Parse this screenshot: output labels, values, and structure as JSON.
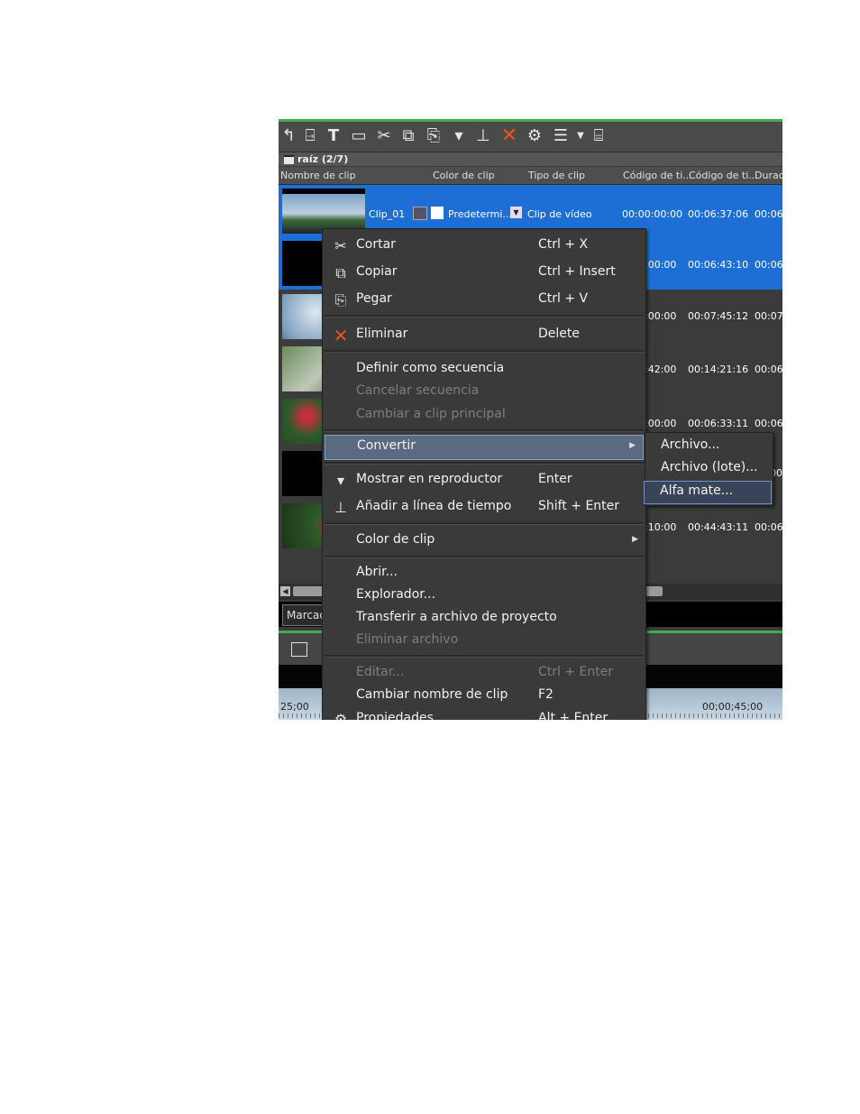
{
  "bin": {
    "label": "raíz (2/7)"
  },
  "columns": [
    "Nombre de clip",
    "Color de clip",
    "Tipo de clip",
    "Código de ti...",
    "Código de ti...",
    "Durac"
  ],
  "rows": [
    {
      "name": "Clip_01",
      "color_label": "Predetermi...",
      "type": "Clip de vídeo",
      "tc_in": "00:00:00:00",
      "tc_out": "00:06:37:06",
      "dur": "00:06:",
      "selected": true
    },
    {
      "tc_in": ":00:00",
      "tc_out": "00:06:43:10",
      "dur": "00:06:",
      "selected": true
    },
    {
      "tc_in": ":00:00",
      "tc_out": "00:07:45:12",
      "dur": "00:07:"
    },
    {
      "tc_in": ":42:00",
      "tc_out": "00:14:21:16",
      "dur": "00:06:"
    },
    {
      "tc_in": ":00:00",
      "tc_out": "00:06:33:11",
      "dur": "00:06:"
    },
    {
      "tc_in": "",
      "tc_out": "",
      "dur": "00:"
    },
    {
      "tc_in": ":10:00",
      "tc_out": "00:44:43:11",
      "dur": "00:06:"
    }
  ],
  "marcas_tab": "Marcad",
  "ruler": {
    "left_tc": "25;00",
    "right_tc": "00;00;45;00"
  },
  "context_menu": {
    "cut": {
      "label": "Cortar",
      "shortcut": "Ctrl + X"
    },
    "copy": {
      "label": "Copiar",
      "shortcut": "Ctrl + Insert"
    },
    "paste": {
      "label": "Pegar",
      "shortcut": "Ctrl + V"
    },
    "delete": {
      "label": "Eliminar",
      "shortcut": "Delete"
    },
    "define_sequence": {
      "label": "Definir como secuencia"
    },
    "cancel_sequence": {
      "label": "Cancelar secuencia"
    },
    "switch_main": {
      "label": "Cambiar a clip principal"
    },
    "convert": {
      "label": "Convertir"
    },
    "show_player": {
      "label": "Mostrar en reproductor",
      "shortcut": "Enter"
    },
    "add_timeline": {
      "label": "Añadir a línea de tiempo",
      "shortcut": "Shift + Enter"
    },
    "clip_color": {
      "label": "Color de clip"
    },
    "open": {
      "label": "Abrir..."
    },
    "explorer": {
      "label": "Explorador..."
    },
    "transfer": {
      "label": "Transferir a archivo de proyecto"
    },
    "delete_file": {
      "label": "Eliminar archivo"
    },
    "edit": {
      "label": "Editar...",
      "shortcut": "Ctrl + Enter"
    },
    "rename": {
      "label": "Cambiar nombre de clip",
      "shortcut": "F2"
    },
    "properties": {
      "label": "Propiedades...",
      "shortcut": "Alt + Enter"
    }
  },
  "submenu": {
    "file": "Archivo...",
    "file_batch": "Archivo (lote)...",
    "alpha_matte": "Alfa mate..."
  },
  "colors": {
    "selection": "#1d6fd6",
    "accent_green": "#3fae49",
    "delete_x": "#e8541c"
  }
}
